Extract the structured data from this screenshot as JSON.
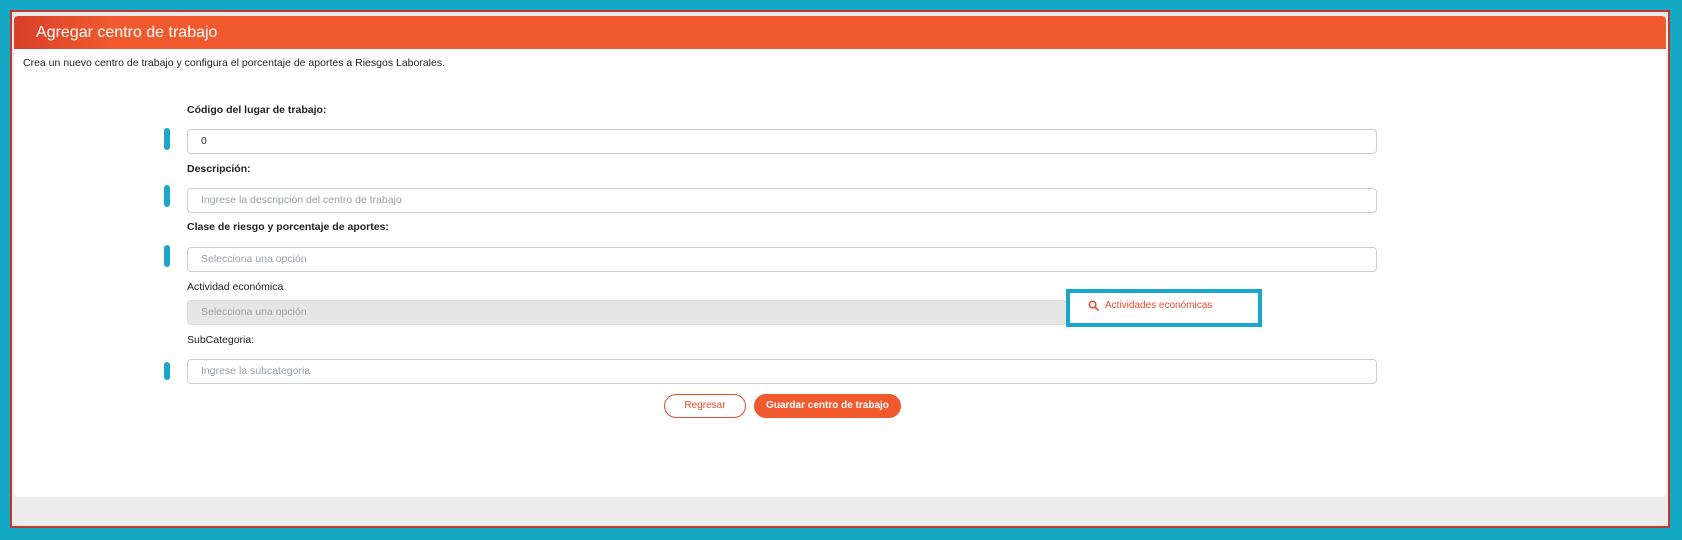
{
  "card": {
    "title": "Agregar centro de trabajo",
    "intro": "Crea un nuevo centro de trabajo y configura el porcentaje de aportes a Riesgos Laborales."
  },
  "fields": {
    "codigo": {
      "label": "Código del lugar de trabajo:",
      "value": "0"
    },
    "descripcion": {
      "label": "Descripción:",
      "placeholder": "Ingrese la descripción del centro de trabajo"
    },
    "clase_riesgo": {
      "label": "Clase de riesgo y porcentaje de aportes:",
      "placeholder": "Selecciona una opción"
    },
    "actividad": {
      "label": "Actividad económica",
      "placeholder": "Selecciona una opción",
      "lookup_label": "Actividades económicas"
    },
    "subcategoria": {
      "label": "SubCategoria:",
      "placeholder": "Ingrese la subcategoria"
    }
  },
  "actions": {
    "back_label": "Regresar",
    "save_label": "Guardar centro de trabajo"
  },
  "colors": {
    "accent": "#f15a2e",
    "highlight": "#1aa7cc"
  }
}
